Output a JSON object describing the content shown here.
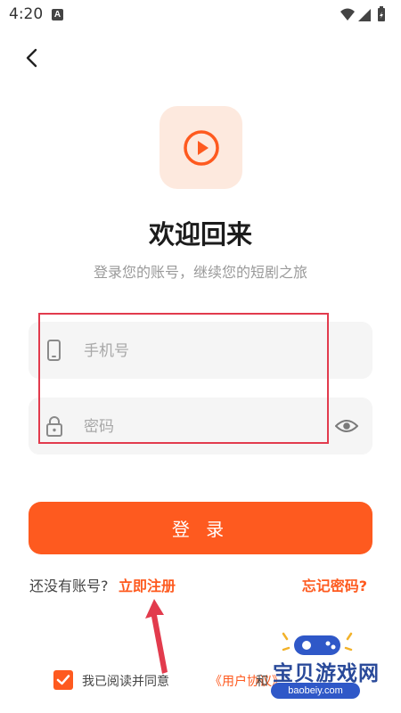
{
  "status_bar": {
    "time": "4:20",
    "notification_letter": "A",
    "icons": [
      "wifi-icon",
      "signal-icon",
      "battery-icon"
    ]
  },
  "header": {
    "back_icon": "chevron-left-icon"
  },
  "logo": {
    "icon": "play-circle-icon",
    "color": "#fe5a1f",
    "background": "#fde9de"
  },
  "title": "欢迎回来",
  "subtitle": "登录您的账号，继续您的短剧之旅",
  "form": {
    "phone": {
      "value": "",
      "placeholder": "手机号",
      "icon": "phone-icon"
    },
    "password": {
      "value": "",
      "placeholder": "密码",
      "icon": "lock-icon",
      "toggle_icon": "eye-icon"
    },
    "login_label": "登 录"
  },
  "links": {
    "no_account_text": "还没有账号?",
    "register_label": "立即注册",
    "forgot_label": "忘记密码?"
  },
  "agreement": {
    "checked": true,
    "text": "我已阅读并同意",
    "user_agreement_label": "《用户协议》",
    "and_text": "和"
  },
  "watermark": {
    "text": "宝贝游戏网",
    "url": "baobeiy.com"
  },
  "colors": {
    "accent": "#fe5a1f",
    "annotation": "#e23b4d"
  }
}
